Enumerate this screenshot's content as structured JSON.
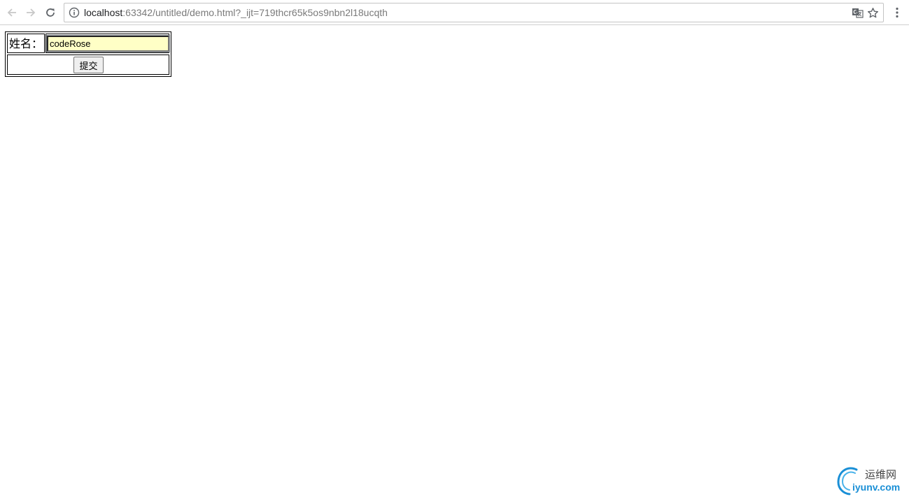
{
  "browser": {
    "url_host": "localhost",
    "url_rest": ":63342/untitled/demo.html?_ijt=719thcr65k5os9nbn2l18ucqth",
    "icons": {
      "back": "arrow-left-icon",
      "forward": "arrow-right-icon",
      "reload": "reload-icon",
      "info": "info-icon",
      "translate": "translate-icon",
      "bookmark": "star-icon",
      "menu": "kebab-menu-icon"
    }
  },
  "form": {
    "name_label": "姓名：",
    "name_value": "codeRose",
    "submit_label": "提交",
    "input_bg": "#ffffc6"
  },
  "watermark": {
    "cn": "运维网",
    "en": "iyunv.com",
    "color": "#1a8fd6"
  }
}
